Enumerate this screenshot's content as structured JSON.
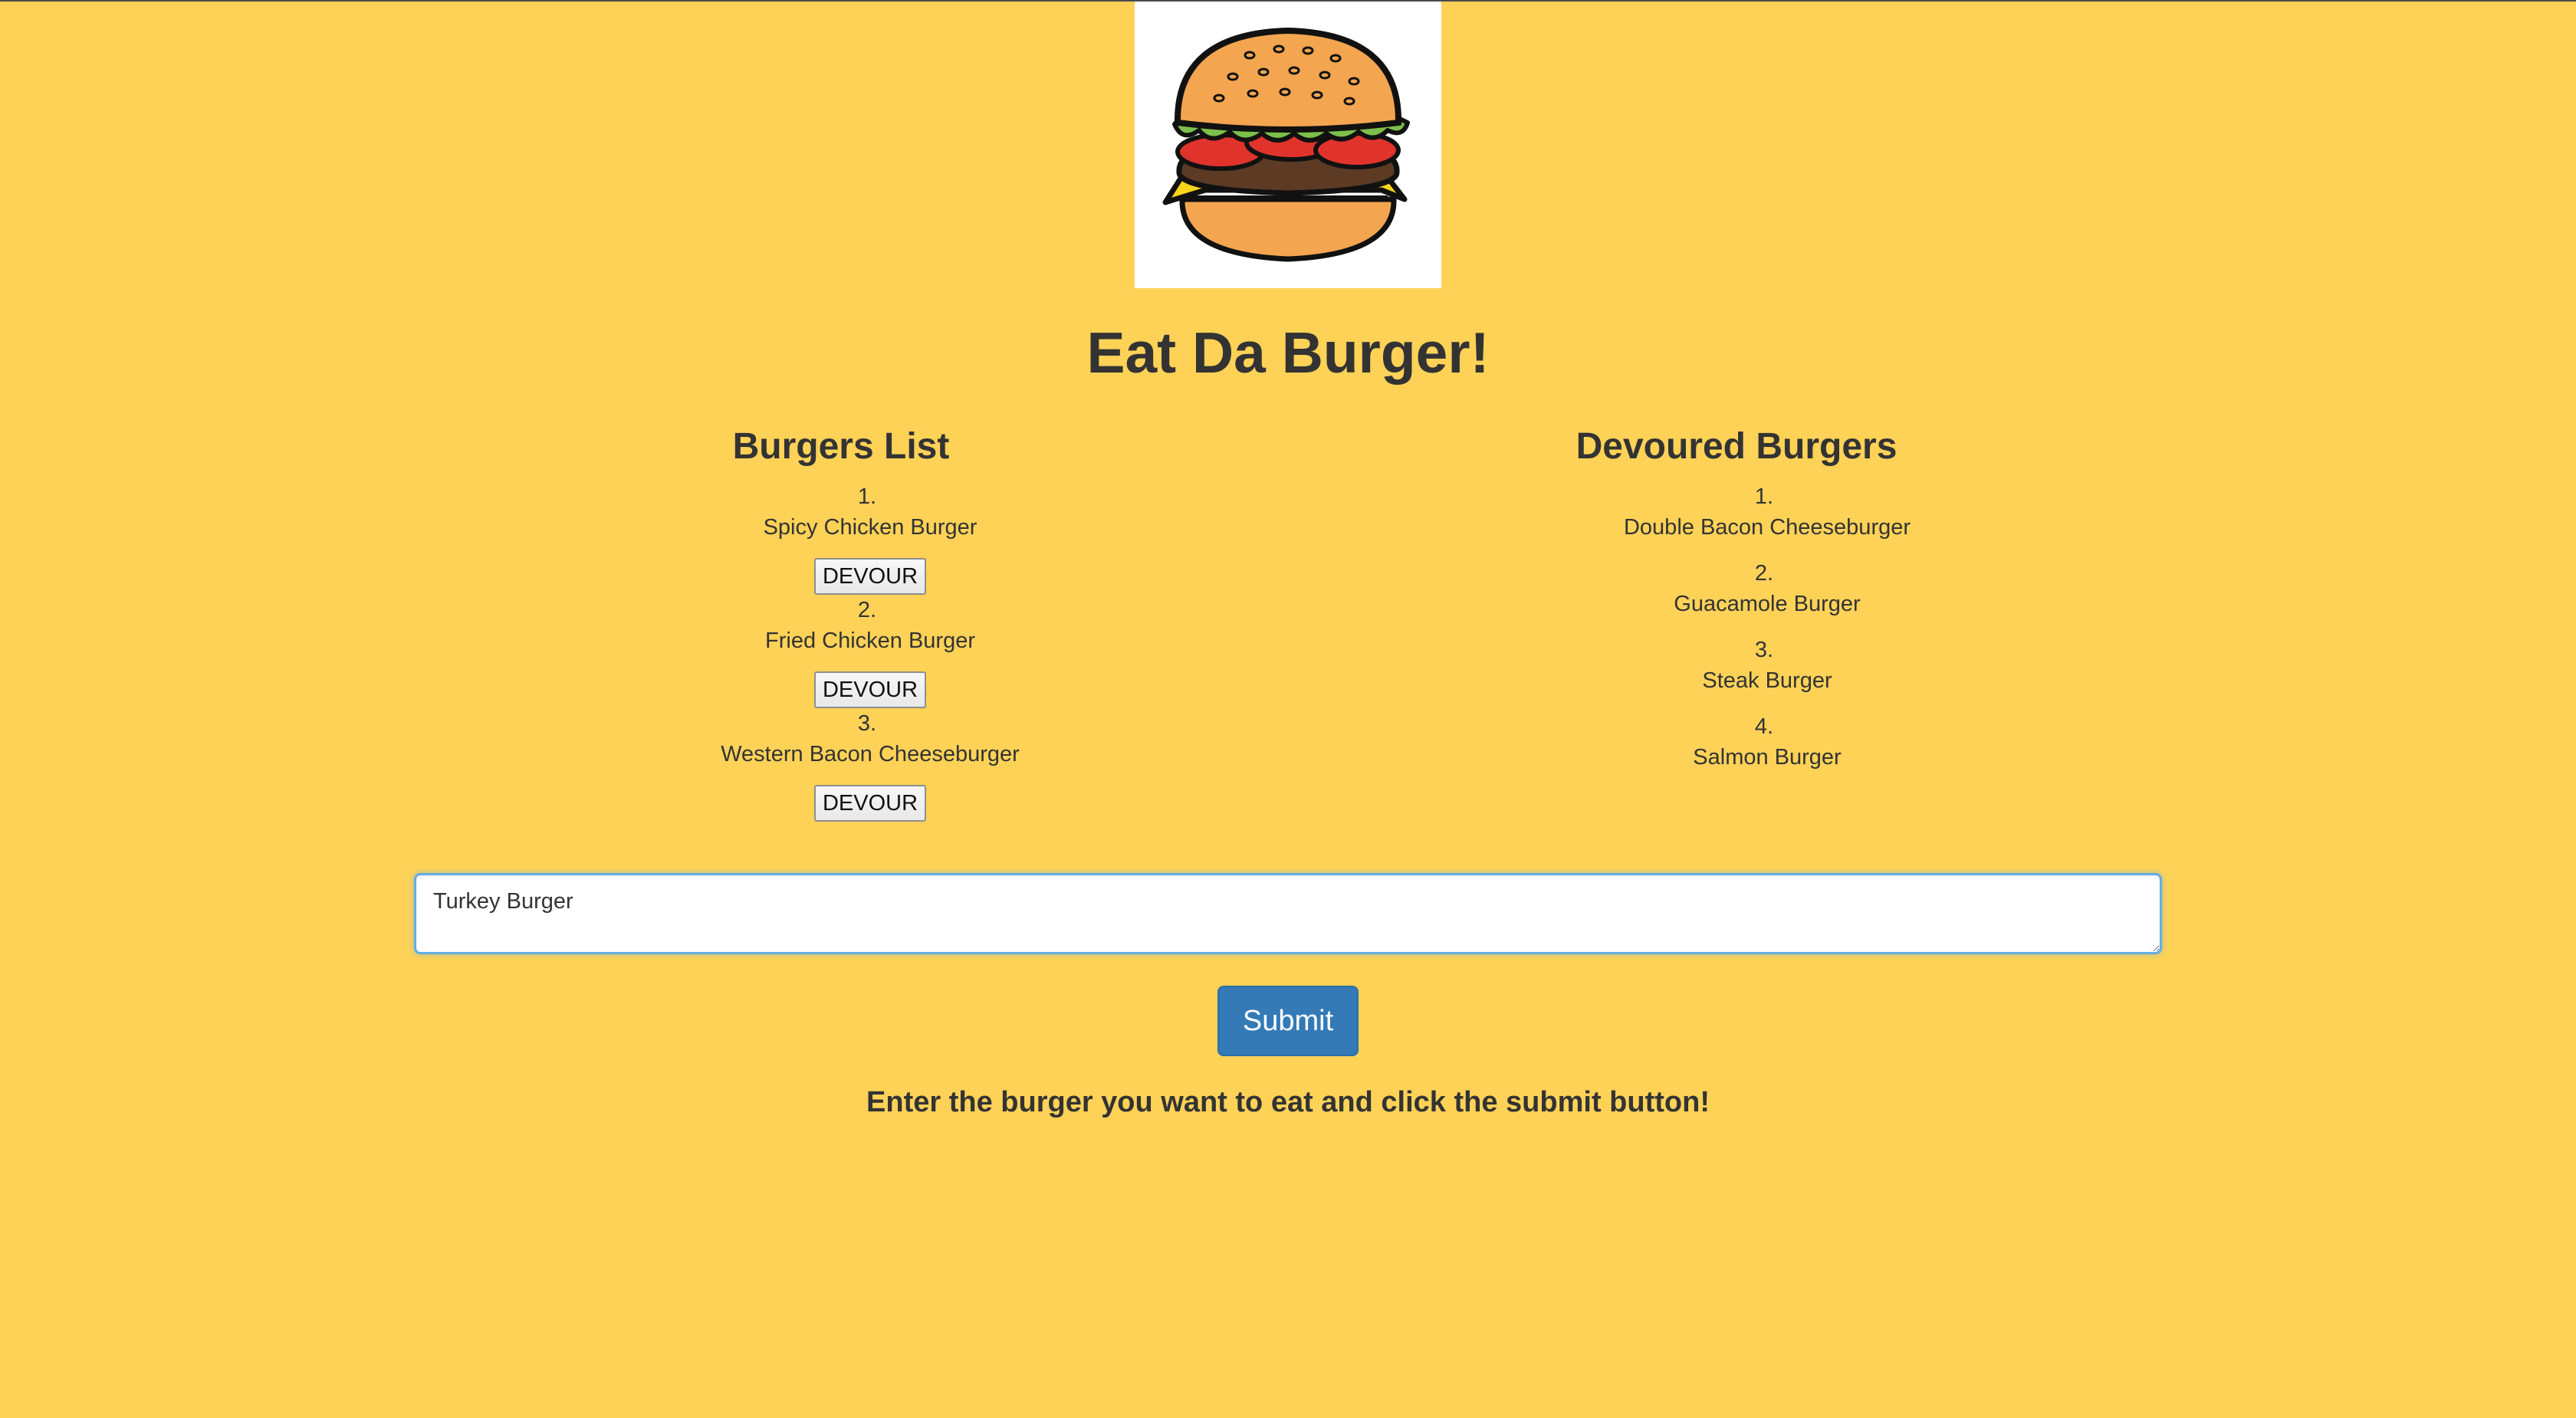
{
  "page": {
    "title": "Eat Da Burger!",
    "logo_icon": "burger-icon",
    "background_color": "#fdd257"
  },
  "burgers_list": {
    "heading": "Burgers List",
    "items": [
      {
        "number": "1.",
        "name": "Spicy Chicken Burger",
        "button_label": "DEVOUR"
      },
      {
        "number": "2.",
        "name": "Fried Chicken Burger",
        "button_label": "DEVOUR"
      },
      {
        "number": "3.",
        "name": "Western Bacon Cheeseburger",
        "button_label": "DEVOUR"
      }
    ]
  },
  "devoured": {
    "heading": "Devoured Burgers",
    "items": [
      {
        "number": "1.",
        "name": "Double Bacon Cheeseburger"
      },
      {
        "number": "2.",
        "name": "Guacamole Burger"
      },
      {
        "number": "3.",
        "name": "Steak Burger"
      },
      {
        "number": "4.",
        "name": "Salmon Burger"
      }
    ]
  },
  "form": {
    "input_value": "Turkey Burger",
    "submit_label": "Submit",
    "submit_color": "#337ab7",
    "instructions": "Enter the burger you want to eat and click the submit button!"
  }
}
